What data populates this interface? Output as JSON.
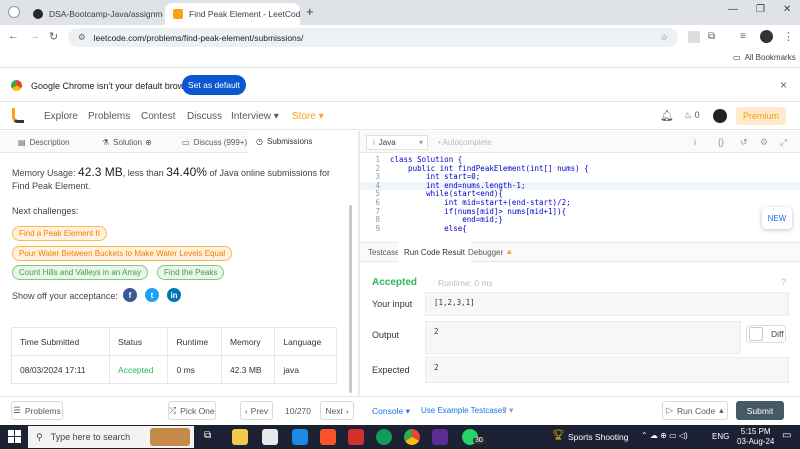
{
  "browser": {
    "tabs": [
      {
        "title": "DSA-Bootcamp-Java/assignme",
        "active": false
      },
      {
        "title": "Find Peak Element - LeetCode",
        "active": true
      }
    ],
    "new_tab": "+",
    "url": "leetcode.com/problems/find-peak-element/submissions/",
    "bookmarks_label": "All Bookmarks",
    "infobar_text": "Google Chrome isn't your default browser",
    "set_default_label": "Set as default",
    "infobar_close": "×"
  },
  "lc_nav": {
    "links": [
      "Explore",
      "Problems",
      "Contest",
      "Discuss",
      "Interview ▾",
      "Store ▾"
    ],
    "notification_count": "0",
    "premium_label": "Premium"
  },
  "left_tabs": [
    "Description",
    "Solution",
    "Discuss (999+)",
    "Submissions"
  ],
  "result_summary": {
    "prefix": "Memory Usage: ",
    "memory": "42.3 MB",
    "middle": ", less than ",
    "percent": "34.40%",
    "suffix": " of Java online submissions for Find Peak Element."
  },
  "next_challenges_label": "Next challenges:",
  "next_challenges": [
    {
      "label": "Find a Peak Element II",
      "difficulty": "medium"
    },
    {
      "label": "Pour Water Between Buckets to Make Water Levels Equal",
      "difficulty": "medium"
    },
    {
      "label": "Count Hills and Valleys in an Array",
      "difficulty": "easy"
    },
    {
      "label": "Find the Peaks",
      "difficulty": "easy"
    }
  ],
  "share_label": "Show off your acceptance:",
  "submissions_table": {
    "headers": [
      "Time Submitted",
      "Status",
      "Runtime",
      "Memory",
      "Language"
    ],
    "rows": [
      [
        "08/03/2024 17:11",
        "Accepted",
        "0 ms",
        "42.3 MB",
        "java"
      ]
    ]
  },
  "editor": {
    "language": "Java",
    "autocomplete": "Autocomplete",
    "lines": [
      {
        "n": "1",
        "code": "class Solution {"
      },
      {
        "n": "2",
        "code": "    public int findPeakElement(int[] nums) {"
      },
      {
        "n": "3",
        "code": "        int start=0;"
      },
      {
        "n": "4",
        "code": "        int end=nums.length-1;"
      },
      {
        "n": "5",
        "code": "        while(start<end){"
      },
      {
        "n": "6",
        "code": "            int mid=start+(end-start)/2;"
      },
      {
        "n": "7",
        "code": "            if(nums[mid]> nums[mid+1]){"
      },
      {
        "n": "8",
        "code": "                end=mid;}"
      },
      {
        "n": "9",
        "code": "            else{"
      }
    ],
    "new_badge": "NEW"
  },
  "console": {
    "tabs": [
      "Testcase",
      "Run Code Result",
      "Debugger"
    ],
    "status": "Accepted",
    "runtime": "Runtime: 0 ms",
    "your_input_label": "Your input",
    "your_input": "[1,2,3,1]",
    "output_label": "Output",
    "output": "2",
    "expected_label": "Expected",
    "expected": "2",
    "diff_label": "Diff"
  },
  "bottom_bar": {
    "problems": "Problems",
    "pick_one": "Pick One",
    "prev": "Prev",
    "page": "10/270",
    "next": "Next",
    "console": "Console",
    "use_example": "Use Example Testcases",
    "run_code": "Run Code",
    "submit": "Submit"
  },
  "taskbar": {
    "search_placeholder": "Type here to search",
    "weather": "Sports Shooting",
    "lang": "ENG",
    "time": "5:15 PM",
    "date": "03-Aug-24",
    "whatsapp_badge": "30"
  },
  "colors": {
    "accent_orange": "#ffa116",
    "accepted_green": "#2db55d",
    "chrome_blue": "#0b57d0"
  }
}
